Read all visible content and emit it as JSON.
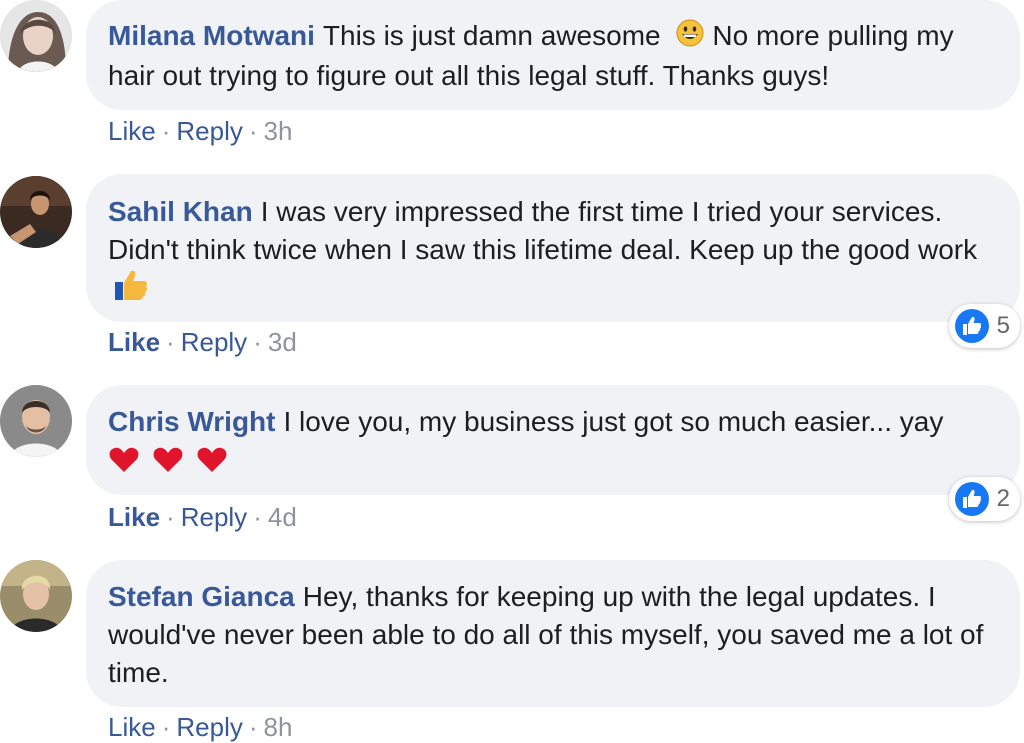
{
  "comments": [
    {
      "author": "Milana Motwani",
      "text_before_emoji": "This is just damn awesome",
      "text_after_emoji": "No more pulling my hair out trying to figure out all this legal stuff. Thanks guys!",
      "like_label": "Like",
      "reply_label": "Reply",
      "time": "3h",
      "emoji": "grinning-face-icon"
    },
    {
      "author": "Sahil Khan",
      "text": "I was very impressed the first time I tried your services. Didn't think twice when I saw this lifetime deal. Keep up the good work",
      "like_label": "Like",
      "reply_label": "Reply",
      "time": "3d",
      "reaction_count": "5",
      "emoji": "thumbs-up-icon"
    },
    {
      "author": "Chris Wright",
      "text": "I love you, my business just got so much easier... yay",
      "like_label": "Like",
      "reply_label": "Reply",
      "time": "4d",
      "reaction_count": "2",
      "emoji": "red-heart-icon"
    },
    {
      "author": "Stefan Gianca",
      "text": "Hey, thanks for keeping up with the legal updates. I would've never been able to do all of this myself, you saved me a lot of time.",
      "like_label": "Like",
      "reply_label": "Reply",
      "time": "8h"
    }
  ],
  "separator": "·",
  "colors": {
    "author_blue": "#385898",
    "bubble_bg": "#f0f2f5",
    "meta_gray": "#8d949e",
    "like_blue": "#1877f2",
    "heart_red": "#e0142a"
  }
}
